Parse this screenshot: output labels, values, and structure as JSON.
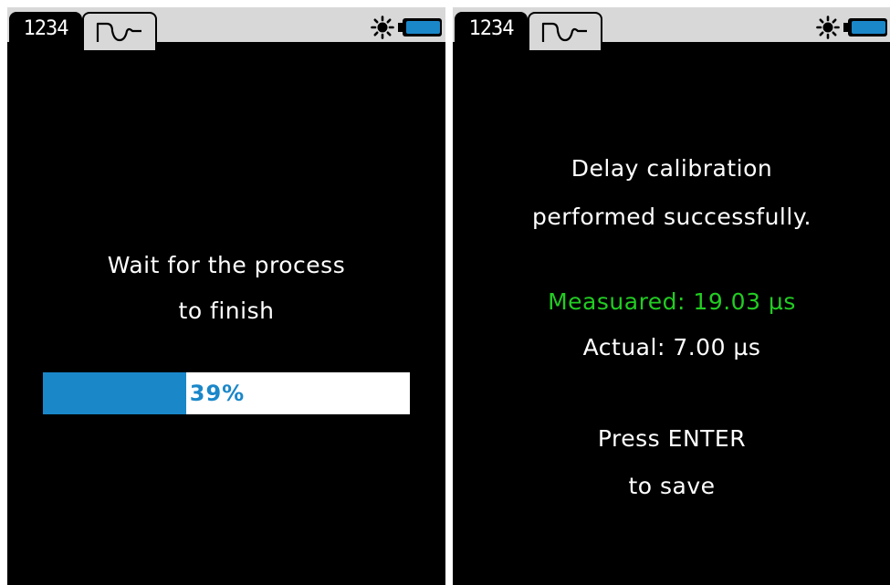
{
  "colors": {
    "screen_bg": "#000000",
    "topbar_bg": "#d8d8d8",
    "accent_blue": "#1a87c9",
    "measured_green": "#22cc22",
    "text": "#ffffff"
  },
  "left_screen": {
    "tabs": [
      {
        "label": "1234",
        "icon": "digits-icon",
        "active": true
      },
      {
        "label": "",
        "icon": "waveform-icon",
        "active": false
      }
    ],
    "status_icons": [
      "brightness-icon",
      "battery-icon"
    ],
    "message_line1": "Wait for the process",
    "message_line2": "to finish",
    "progress": {
      "value": 39,
      "label": "39%"
    }
  },
  "right_screen": {
    "tabs": [
      {
        "label": "1234",
        "icon": "digits-icon",
        "active": true
      },
      {
        "label": "",
        "icon": "waveform-icon",
        "active": false
      }
    ],
    "status_icons": [
      "brightness-icon",
      "battery-icon"
    ],
    "message_line1": "Delay calibration",
    "message_line2": "performed successfully.",
    "measured": "Measuared: 19.03 µs",
    "actual": "Actual: 7.00 µs",
    "instruction_line1": "Press ENTER",
    "instruction_line2": "to save"
  }
}
